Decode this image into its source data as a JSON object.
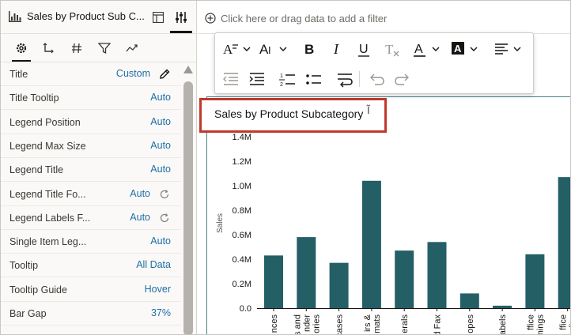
{
  "panel": {
    "title": "Sales by Product Sub C...",
    "properties": [
      {
        "label": "Title",
        "value": "Custom",
        "icon": "pencil-icon"
      },
      {
        "label": "Title Tooltip",
        "value": "Auto"
      },
      {
        "label": "Legend Position",
        "value": "Auto"
      },
      {
        "label": "Legend Max Size",
        "value": "Auto"
      },
      {
        "label": "Legend Title",
        "value": "Auto"
      },
      {
        "label": "Legend Title Fo...",
        "value": "Auto",
        "icon": "reset-icon"
      },
      {
        "label": "Legend Labels F...",
        "value": "Auto",
        "icon": "reset-icon"
      },
      {
        "label": "Single Item Leg...",
        "value": "Auto"
      },
      {
        "label": "Tooltip",
        "value": "All Data"
      },
      {
        "label": "Tooltip Guide",
        "value": "Hover"
      },
      {
        "label": "Bar Gap",
        "value": "37%"
      }
    ]
  },
  "filter_bar": {
    "placeholder": "Click here or drag data to add a filter"
  },
  "toolbar": {
    "row1": [
      "font-family-icon",
      "font-size-icon",
      "bold-icon",
      "italic-icon",
      "underline-icon",
      "clear-format-icon",
      "font-color-icon",
      "highlight-color-icon",
      "align-icon"
    ],
    "row2": [
      "outdent-icon",
      "indent-icon",
      "numbered-list-icon",
      "bullet-list-icon",
      "wrap-icon",
      "undo-icon",
      "redo-icon"
    ]
  },
  "chart_data": {
    "type": "bar",
    "title": "Sales by Product Subcategory",
    "ylabel": "Sales",
    "ylim": [
      0,
      1.4
    ],
    "yticks": [
      "0.0",
      "0.2M",
      "0.4M",
      "0.6M",
      "0.8M",
      "1.0M",
      "1.2M",
      "1.4M"
    ],
    "categories": [
      "...nces",
      "...s and ...nder ...ories",
      "...cases",
      "...irs & ...mats",
      "...erals",
      "...nd Fax",
      "...opes",
      "...abels",
      "...ffice ...hings",
      "...ffice ...plies"
    ],
    "category_labels": [
      [
        "nces"
      ],
      [
        "s and",
        "nder",
        "ories"
      ],
      [
        "cases"
      ],
      [
        "irs &",
        "mats"
      ],
      [
        "erals"
      ],
      [
        "nd Fax"
      ],
      [
        "opes"
      ],
      [
        "abels"
      ],
      [
        "ffice",
        "nings"
      ],
      [
        "ffice",
        "plies"
      ]
    ],
    "values": [
      0.43,
      0.58,
      0.37,
      1.04,
      0.47,
      0.54,
      0.12,
      0.02,
      0.44,
      1.07
    ],
    "bar_color": "#245f66"
  }
}
